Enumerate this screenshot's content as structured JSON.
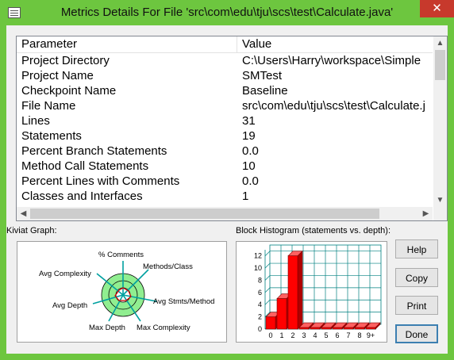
{
  "window": {
    "title": "Metrics Details For File 'src\\com\\edu\\tju\\scs\\test\\Calculate.java'",
    "close_glyph": "✕"
  },
  "table": {
    "headers": [
      "Parameter",
      "Value"
    ],
    "rows": [
      {
        "param": "Project Directory",
        "value": "C:\\Users\\Harry\\workspace\\Simple"
      },
      {
        "param": "Project Name",
        "value": "SMTest"
      },
      {
        "param": "Checkpoint Name",
        "value": "Baseline"
      },
      {
        "param": "File Name",
        "value": "src\\com\\edu\\tju\\scs\\test\\Calculate.j"
      },
      {
        "param": "Lines",
        "value": "31"
      },
      {
        "param": "Statements",
        "value": "19"
      },
      {
        "param": "Percent Branch Statements",
        "value": "0.0"
      },
      {
        "param": "Method Call Statements",
        "value": "10"
      },
      {
        "param": "Percent Lines with Comments",
        "value": "0.0"
      },
      {
        "param": "Classes and Interfaces",
        "value": "1"
      }
    ]
  },
  "kiviat": {
    "label": "Kiviat Graph:",
    "axes": [
      "% Comments",
      "Methods/Class",
      "Avg Stmts/Method",
      "Max Complexity",
      "Max Depth",
      "Avg Depth",
      "Avg Complexity"
    ]
  },
  "histogram": {
    "label": "Block Histogram (statements vs. depth):",
    "y_ticks": [
      "0",
      "2",
      "4",
      "6",
      "8",
      "10",
      "12"
    ],
    "categories": [
      "0",
      "1",
      "2",
      "3",
      "4",
      "5",
      "6",
      "7",
      "8",
      "9+"
    ],
    "values": [
      2,
      5,
      12,
      0,
      0,
      0,
      0,
      0,
      0,
      0
    ],
    "bar_color": "#ff0000"
  },
  "buttons": {
    "help": "Help",
    "copy": "Copy",
    "print": "Print",
    "done": "Done"
  },
  "icons": {
    "scroll_up": "▲",
    "scroll_down": "▼",
    "scroll_left": "◀",
    "scroll_right": "▶"
  }
}
